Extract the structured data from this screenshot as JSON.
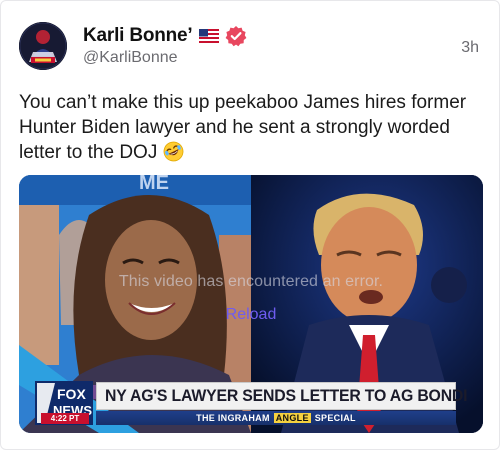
{
  "post": {
    "author": {
      "display_name": "Karli Bonne’",
      "handle": "@KarliBonne",
      "flag_icon": "us-flag-icon",
      "verified_icon": "verified-badge-icon",
      "verified_color": "#e8475f"
    },
    "timestamp": "3h",
    "text": "You can’t make this up peekaboo James hires former Hunter Biden lawyer and he sent a strongly worded letter to the DOJ",
    "text_emoji": "rolling-on-floor-laughing-emoji"
  },
  "media": {
    "error_message": "This video has encountered an error.",
    "reload_label": "Reload",
    "reload_color": "#6e5cf0",
    "chyron": {
      "network": "FOX NEWS",
      "time": "4:22 PT",
      "headline": "NY AG'S LAWYER SENDS LETTER TO AG BONDI",
      "show_name": "THE INGRAHAM",
      "show_angle": "ANGLE",
      "show_special": "SPECIAL"
    }
  }
}
